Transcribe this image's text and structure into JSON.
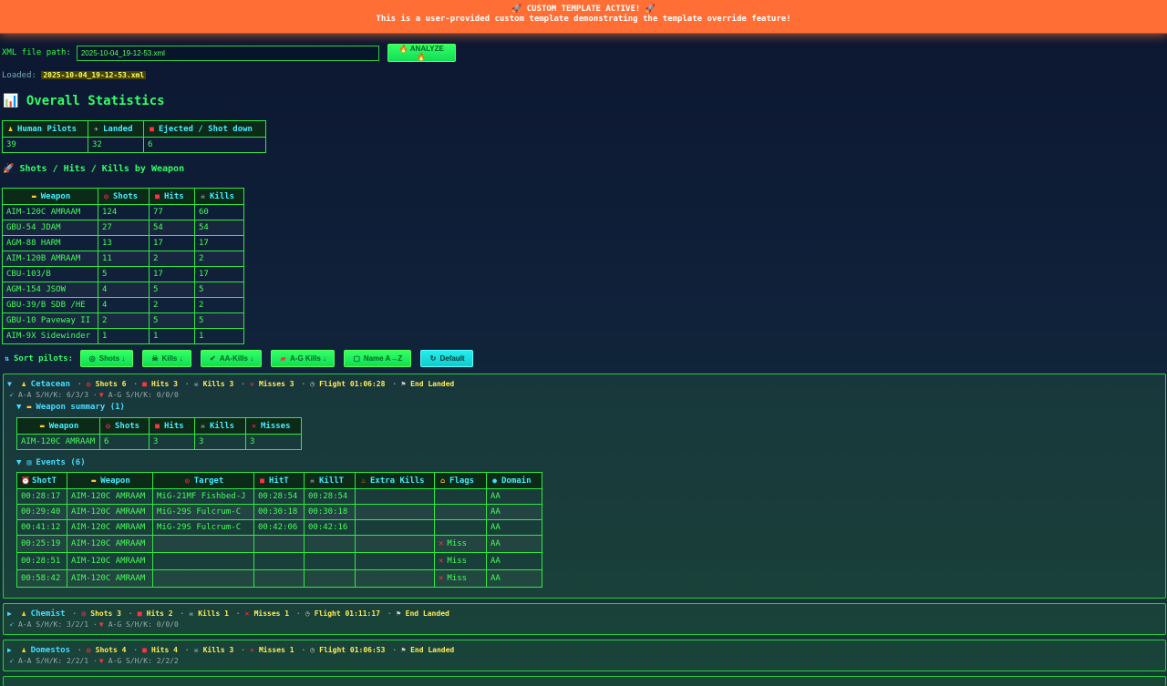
{
  "banner": {
    "line1": "🚀 CUSTOM TEMPLATE ACTIVE! 🚀",
    "line2": "This is a user-provided custom template demonstrating the template override feature!"
  },
  "path": {
    "label": "XML file path:",
    "value": "2025-10-04_19-12-53.xml",
    "analyze_label": "🔥 ANALYZE 🔥"
  },
  "loaded": {
    "label": "Loaded:",
    "file": "2025-10-04_19-12-53.xml"
  },
  "overall": {
    "title": "📊 Overall Statistics",
    "headers": [
      "Human Pilots",
      "Landed",
      "Ejected / Shot down"
    ],
    "values": [
      "39",
      "32",
      "6"
    ]
  },
  "weapons": {
    "title": "🚀 Shots / Hits / Kills by Weapon",
    "headers": [
      "Weapon",
      "Shots",
      "Hits",
      "Kills"
    ],
    "rows": [
      [
        "AIM-120C AMRAAM",
        "124",
        "77",
        "60"
      ],
      [
        "GBU-54 JDAM",
        "27",
        "54",
        "54"
      ],
      [
        "AGM-88 HARM",
        "13",
        "17",
        "17"
      ],
      [
        "AIM-120B AMRAAM",
        "11",
        "2",
        "2"
      ],
      [
        "CBU-103/B",
        "5",
        "17",
        "17"
      ],
      [
        "AGM-154 JSOW",
        "4",
        "5",
        "5"
      ],
      [
        "GBU-39/B SDB /HE",
        "4",
        "2",
        "2"
      ],
      [
        "GBU-10 Paveway II",
        "2",
        "5",
        "5"
      ],
      [
        "AIM-9X Sidewinder",
        "1",
        "1",
        "1"
      ]
    ]
  },
  "sort": {
    "label": "Sort pilots:",
    "buttons": [
      "Shots ↓",
      "Kills ↓",
      "AA-Kills ↓",
      "A-G Kills ↓",
      "Name A→Z",
      "Default"
    ]
  },
  "pilots": [
    {
      "name": "Cetacean",
      "shots": "Shots 6",
      "hits": "Hits 3",
      "kills": "Kills 3",
      "misses": "Misses 3",
      "flight": "Flight 01:06:28",
      "end": "End Landed",
      "aa": "A-A S/H/K: 6/3/3",
      "ag": "A-G S/H/K: 0/0/0",
      "weapon_summary_title": "Weapon summary (1)",
      "ws_headers": [
        "Weapon",
        "Shots",
        "Hits",
        "Kills",
        "Misses"
      ],
      "ws_row": [
        "AIM-120C AMRAAM",
        "6",
        "3",
        "3",
        "3"
      ],
      "events_title": "Events (6)",
      "ev_headers": [
        "ShotT",
        "Weapon",
        "Target",
        "HitT",
        "KillT",
        "Extra Kills",
        "Flags",
        "Domain"
      ],
      "events": [
        [
          "00:28:17",
          "AIM-120C AMRAAM",
          "MiG-21MF Fishbed-J",
          "00:28:54",
          "00:28:54",
          "",
          "",
          "AA"
        ],
        [
          "00:29:40",
          "AIM-120C AMRAAM",
          "MiG-29S Fulcrum-C",
          "00:30:18",
          "00:30:18",
          "",
          "",
          "AA"
        ],
        [
          "00:41:12",
          "AIM-120C AMRAAM",
          "MiG-29S Fulcrum-C",
          "00:42:06",
          "00:42:16",
          "",
          "",
          "AA"
        ],
        [
          "00:25:19",
          "AIM-120C AMRAAM",
          "",
          "",
          "",
          "",
          "Miss",
          "AA"
        ],
        [
          "00:28:51",
          "AIM-120C AMRAAM",
          "",
          "",
          "",
          "",
          "Miss",
          "AA"
        ],
        [
          "00:58:42",
          "AIM-120C AMRAAM",
          "",
          "",
          "",
          "",
          "Miss",
          "AA"
        ]
      ]
    },
    {
      "name": "Chemist",
      "shots": "Shots 3",
      "hits": "Hits 2",
      "kills": "Kills 1",
      "misses": "Misses 1",
      "flight": "Flight 01:11:17",
      "end": "End Landed",
      "aa": "A-A S/H/K: 3/2/1",
      "ag": "A-G S/H/K: 0/0/0"
    },
    {
      "name": "Domestos",
      "shots": "Shots 4",
      "hits": "Hits 4",
      "kills": "Kills 3",
      "misses": "Misses 1",
      "flight": "Flight 01:06:53",
      "end": "End Landed",
      "aa": "A-A S/H/K: 2/2/1",
      "ag": "A-G S/H/K: 2/2/2"
    }
  ],
  "colors": {
    "banner": "#ff6f35",
    "accent_green": "#33ff44",
    "header_cyan": "#44eeff",
    "summary_yellow": "#ffee55",
    "miss_red": "#ff3344"
  }
}
